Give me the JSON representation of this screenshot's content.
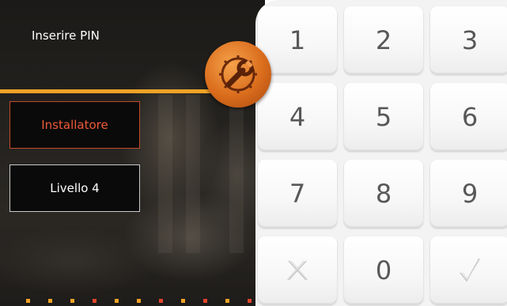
{
  "header": {
    "title": "Inserire PIN"
  },
  "buttons": {
    "installer_label": "Installatore",
    "level_label": "Livello 4"
  },
  "badge": {
    "icon": "wrench-gear-icon"
  },
  "keypad": {
    "keys": [
      "1",
      "2",
      "3",
      "4",
      "5",
      "6",
      "7",
      "8",
      "9",
      "",
      "0",
      ""
    ],
    "clear_icon": "clear-x-icon",
    "confirm_icon": "checkmark-icon"
  },
  "colors": {
    "accent": "#f0a326",
    "installer": "#ee5a38",
    "dots": [
      "#f0a326",
      "#e0442a"
    ]
  }
}
